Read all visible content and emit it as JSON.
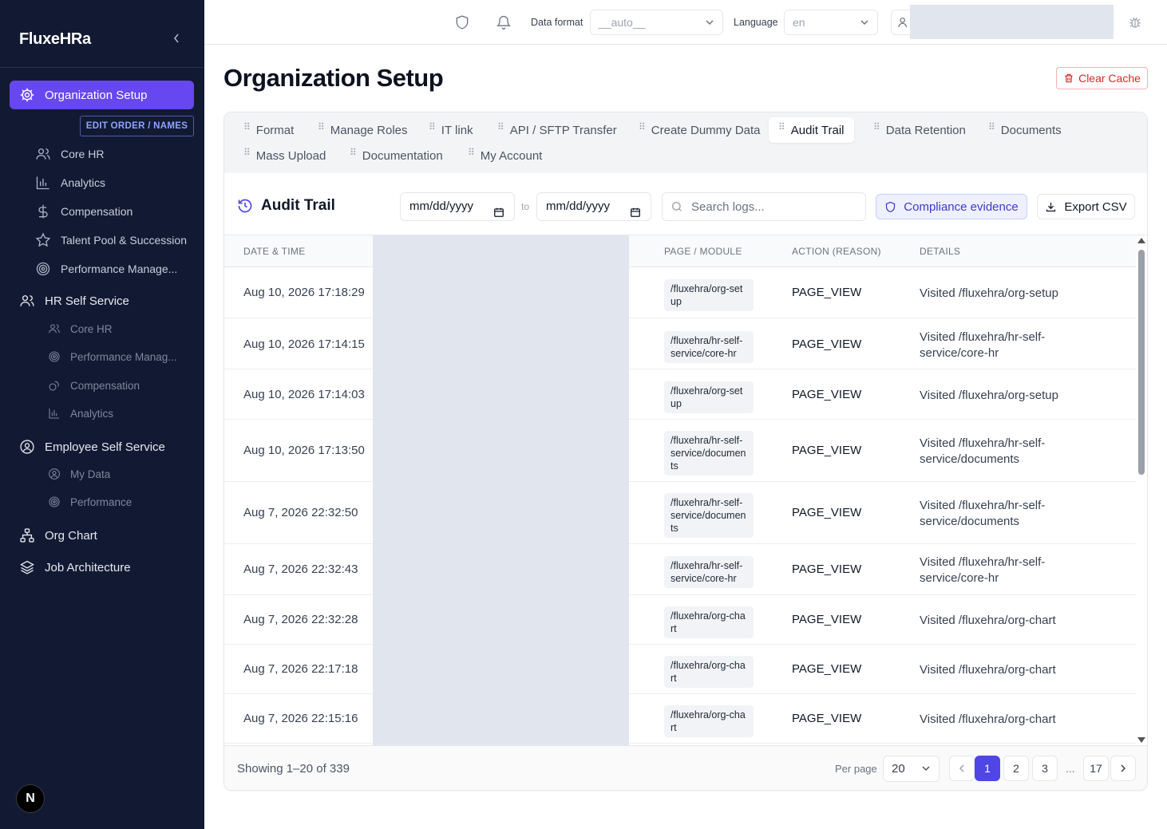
{
  "app": {
    "brand": "FluxeHRa",
    "collapse_glyph": "‹"
  },
  "sidebar": {
    "active_item": "Organization Setup",
    "edit_order_label": "EDIT ORDER / NAMES",
    "org_items": [
      "Core HR",
      "Analytics",
      "Compensation",
      "Talent Pool & Succession",
      "Performance Manage..."
    ],
    "hr_self_service": "HR Self Service",
    "hr_items": [
      "Core HR",
      "Performance Manag...",
      "Compensation",
      "Analytics"
    ],
    "employee_self_service": "Employee Self Service",
    "ess_items": [
      "My Data",
      "Performance"
    ],
    "org_chart": "Org Chart",
    "job_architecture": "Job Architecture",
    "n_badge": "N"
  },
  "topbar": {
    "data_format_label": "Data format",
    "data_format_value": "__auto__",
    "language_label": "Language",
    "language_value": "en"
  },
  "page": {
    "title": "Organization Setup",
    "clear_cache": "Clear Cache"
  },
  "tabs": [
    "Format",
    "Manage Roles",
    "IT link",
    "API / SFTP Transfer",
    "Create Dummy Data",
    "Audit Trail",
    "Data Retention",
    "Documents",
    "Mass Upload",
    "Documentation",
    "My Account"
  ],
  "active_tab": "Audit Trail",
  "audit": {
    "title": "Audit Trail",
    "date_from": "mm/dd/yyyy",
    "to_label": "to",
    "date_to": "mm/dd/yyyy",
    "search_placeholder": "Search logs...",
    "compliance_button": "Compliance evidence",
    "export_button": "Export CSV",
    "columns": [
      "DATE & TIME",
      "PAGE / MODULE",
      "ACTION (REASON)",
      "DETAILS"
    ],
    "rows": [
      {
        "date": "Aug 10, 2026 17:18:29",
        "module": "/fluxehra/org-setup",
        "action": "PAGE_VIEW",
        "details": "Visited /fluxehra/org-setup"
      },
      {
        "date": "Aug 10, 2026 17:14:15",
        "module": "/fluxehra/hr-self-service/core-hr",
        "action": "PAGE_VIEW",
        "details": "Visited /fluxehra/hr-self-service/core-hr"
      },
      {
        "date": "Aug 10, 2026 17:14:03",
        "module": "/fluxehra/org-setup",
        "action": "PAGE_VIEW",
        "details": "Visited /fluxehra/org-setup"
      },
      {
        "date": "Aug 10, 2026 17:13:50",
        "module": "/fluxehra/hr-self-service/documents",
        "action": "PAGE_VIEW",
        "details": "Visited /fluxehra/hr-self-service/documents"
      },
      {
        "date": "Aug 7, 2026 22:32:50",
        "module": "/fluxehra/hr-self-service/documents",
        "action": "PAGE_VIEW",
        "details": "Visited /fluxehra/hr-self-service/documents"
      },
      {
        "date": "Aug 7, 2026 22:32:43",
        "module": "/fluxehra/hr-self-service/core-hr",
        "action": "PAGE_VIEW",
        "details": "Visited /fluxehra/hr-self-service/core-hr"
      },
      {
        "date": "Aug 7, 2026 22:32:28",
        "module": "/fluxehra/org-chart",
        "action": "PAGE_VIEW",
        "details": "Visited /fluxehra/org-chart"
      },
      {
        "date": "Aug 7, 2026 22:17:18",
        "module": "/fluxehra/org-chart",
        "action": "PAGE_VIEW",
        "details": "Visited /fluxehra/org-chart"
      },
      {
        "date": "Aug 7, 2026 22:15:16",
        "module": "/fluxehra/org-chart",
        "action": "PAGE_VIEW",
        "details": "Visited /fluxehra/org-chart"
      }
    ]
  },
  "footer": {
    "showing": "Showing 1–20 of 339",
    "per_page_label": "Per page",
    "per_page_value": "20",
    "pages": [
      "1",
      "2",
      "3",
      "17"
    ],
    "ellipsis": "...",
    "current_page": "1"
  },
  "colors": {
    "sidebar_bg": "#121a33",
    "accent": "#6747f0",
    "primary": "#4f46e5",
    "danger": "#dc2626"
  }
}
